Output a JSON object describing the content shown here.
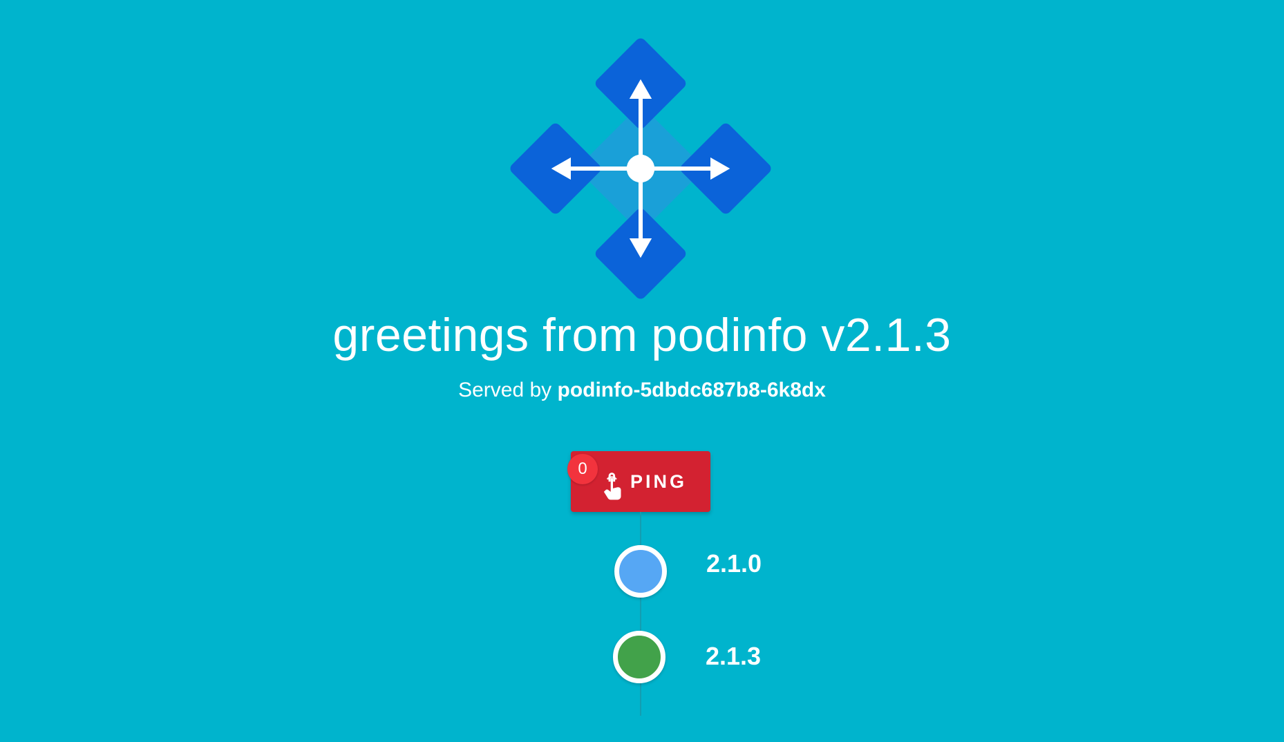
{
  "header": {
    "title": "greetings from podinfo v2.1.3",
    "served_prefix": "Served by",
    "host": "podinfo-5dbdc687b8-6k8dx"
  },
  "ping": {
    "label": "PING",
    "count": "0"
  },
  "timeline": {
    "items": [
      {
        "label": "2.1.0",
        "color": "#56a7f4"
      },
      {
        "label": "2.1.3",
        "color": "#42a24a"
      }
    ]
  },
  "colors": {
    "background": "#00b4cd",
    "logo_blue": "#0b63d9",
    "ping_red": "#d32231",
    "badge_red": "#f2333d"
  }
}
